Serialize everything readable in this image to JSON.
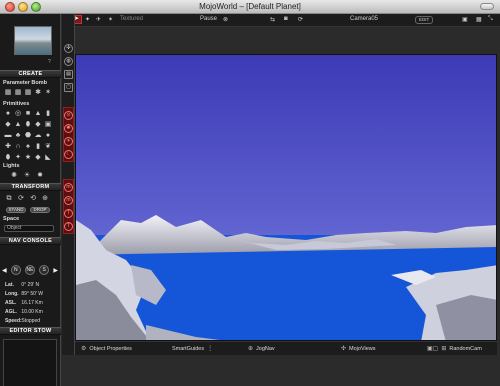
{
  "window": {
    "title": "MojoWorld – [Default Planet]"
  },
  "left_panel": {
    "thumbnail_caption": "?",
    "create": {
      "title": "CREATE",
      "parameter_bomb": "Parameter Bomb",
      "primitives": "Primitives",
      "lights": "Lights"
    },
    "transform": {
      "title": "TRANSFORM",
      "stand_label": "STAND",
      "drop_label": "DROP",
      "space_label": "Space",
      "space_value": "Object"
    },
    "nav_console": {
      "title": "NAV CONSOLE",
      "btn_n": "N",
      "btn_ne": "NE",
      "btn_s": "S",
      "rows": [
        {
          "label": "Lat.",
          "value": "0° 29' N"
        },
        {
          "label": "Long.",
          "value": "89° 50' W"
        },
        {
          "label": "ASL.",
          "value": "16.17 Km"
        },
        {
          "label": "AGL.",
          "value": "10.00 Km"
        },
        {
          "label": "Speed:",
          "value": "Stopped"
        }
      ]
    },
    "editor_stow": {
      "title": "EDITOR STOW"
    }
  },
  "toolbar": {
    "render_mode": "Textured",
    "pause": "Pause",
    "camera": "Camera05",
    "edit": "EDIT"
  },
  "bottombar": {
    "object_properties": "Object Properties",
    "smartguides": "SmartGuides",
    "jognav": "JogNav",
    "mojoviews": "MojoViews",
    "randomcam": "RandomCam"
  },
  "vstrip_icons": [
    "compass-icon",
    "globe-icon",
    "layers-icon",
    "panel-icon",
    "camera-icon",
    "sun-icon",
    "sun2-icon",
    "moon-icon",
    "m-icon",
    "m2-icon",
    "t-icon",
    "t2-icon"
  ],
  "colors": {
    "sky_top": "#3e3fb8",
    "sky_bottom": "#8a8ee0",
    "water": "#1556d8",
    "accent_red": "#8a2020"
  }
}
